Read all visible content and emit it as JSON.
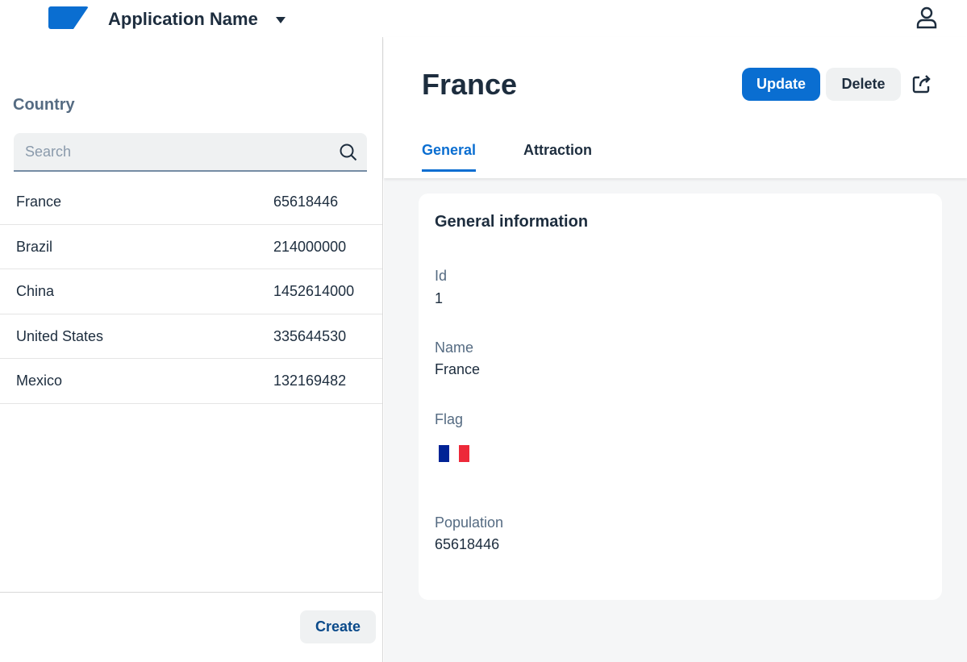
{
  "shell": {
    "app_name": "Application Name"
  },
  "list": {
    "title": "Country",
    "search_placeholder": "Search",
    "rows": [
      {
        "name": "France",
        "population": "65618446"
      },
      {
        "name": "Brazil",
        "population": "214000000"
      },
      {
        "name": "China",
        "population": "1452614000"
      },
      {
        "name": "United States",
        "population": "335644530"
      },
      {
        "name": "Mexico",
        "population": "132169482"
      }
    ],
    "create_label": "Create"
  },
  "detail": {
    "title": "France",
    "update_label": "Update",
    "delete_label": "Delete",
    "tabs": [
      {
        "label": "General",
        "active": true
      },
      {
        "label": "Attraction",
        "active": false
      }
    ],
    "card_title": "General information",
    "fields": {
      "id_label": "Id",
      "id": "1",
      "name_label": "Name",
      "name": "France",
      "flag_label": "Flag",
      "population_label": "Population",
      "population": "65618446"
    },
    "flag_colors": [
      "#002395",
      "#ffffff",
      "#ed2939"
    ]
  },
  "colors": {
    "accent": "#0a6ed1"
  }
}
